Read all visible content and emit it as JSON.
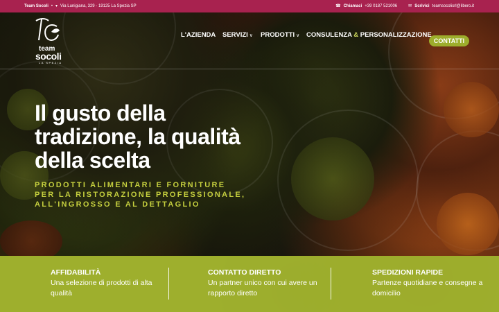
{
  "topbar": {
    "brand": "Team Socoli",
    "address": "Via Lunigiana, 329 - 19125 La Spezia SP",
    "call_label": "Chiamaci",
    "phone": "+39 0187 521006",
    "write_label": "Scrivici",
    "email": "teamsocolisrl@libero.it",
    "pin_icon": "map-pin-icon",
    "phone_icon": "phone-icon",
    "mail_icon": "envelope-icon"
  },
  "logo": {
    "line1": "team",
    "line2": "socoli",
    "line3": "LA SPEZIA"
  },
  "nav": {
    "items": [
      {
        "label": "L'AZIENDA",
        "dropdown": false
      },
      {
        "label": "SERVIZI",
        "dropdown": true
      },
      {
        "label": "PRODOTTI",
        "dropdown": true
      },
      {
        "label_a": "CONSULENZA",
        "amp": "&",
        "label_b": "PERSONALIZZAZIONE",
        "dropdown": false
      }
    ],
    "cta": "CONTATTI"
  },
  "hero": {
    "headline": "Il gusto della tradizione, la qualità della scelta",
    "subline": "PRODOTTI ALIMENTARI E FORNITURE PER LA RISTORAZIONE PROFESSIONALE, ALL'INGROSSO E AL DETTAGLIO"
  },
  "features": [
    {
      "title": "AFFIDABILITÀ",
      "text": "Una selezione di prodotti di alta qualità"
    },
    {
      "title": "CONTATTO DIRETTO",
      "text": "Un partner unico con cui avere un rapporto diretto"
    },
    {
      "title": "SPEDIZIONI RAPIDE",
      "text": "Partenze quotidiane e consegne a domicilio"
    }
  ],
  "colors": {
    "topbar": "#a8224f",
    "accent": "#9dad2c",
    "subline": "#c5cf3e"
  }
}
